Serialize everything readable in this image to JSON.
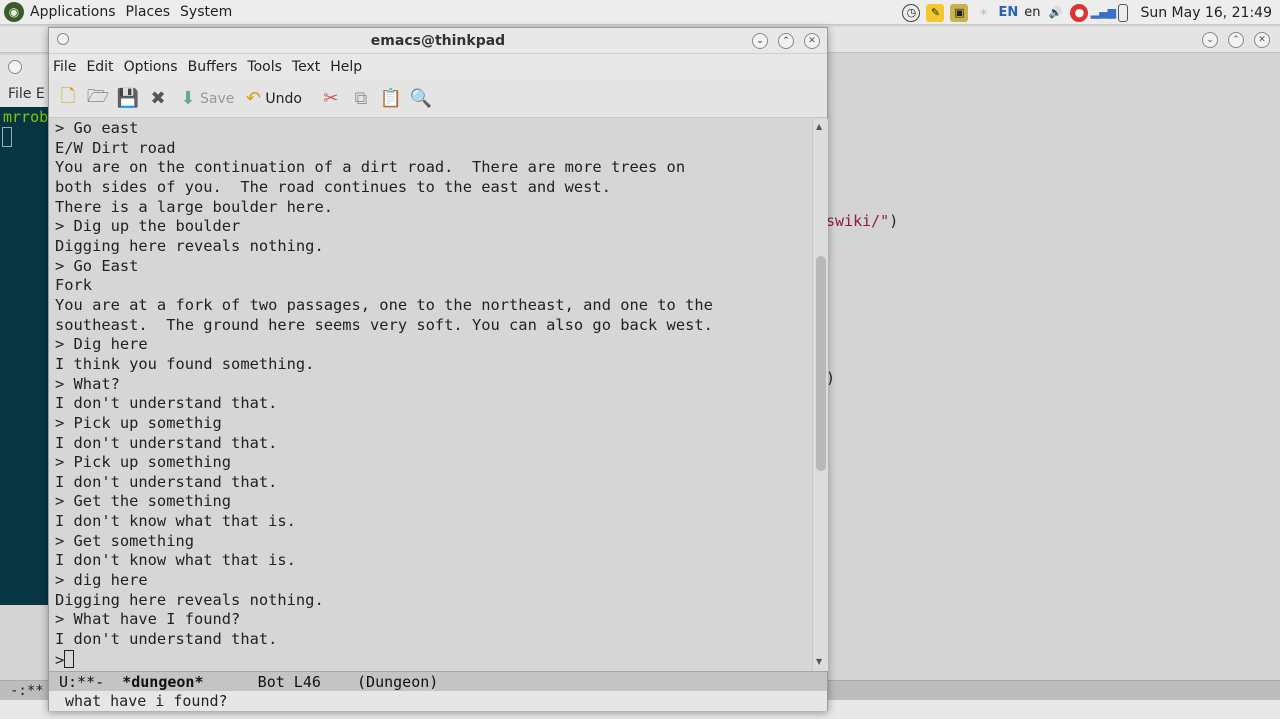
{
  "panel": {
    "menus": [
      "Applications",
      "Places",
      "System"
    ],
    "tray": {
      "lang_upper": "EN",
      "lang_lower": "en",
      "clock": "Sun May 16, 21:49"
    }
  },
  "background": {
    "code_line1": "swiki/\"",
    "code_line1_close": ")",
    "code_line2": ")",
    "modeline": "-:**",
    "terminal_menu": "File  E",
    "terminal_prompt": "mrrob"
  },
  "emacs": {
    "title": "emacs@thinkpad",
    "menu": [
      "File",
      "Edit",
      "Options",
      "Buffers",
      "Tools",
      "Text",
      "Help"
    ],
    "toolbar": {
      "save_label": "Save",
      "undo_label": "Undo"
    },
    "buffer_lines": [
      "> Go east",
      "E/W Dirt road",
      "You are on the continuation of a dirt road.  There are more trees on",
      "both sides of you.  The road continues to the east and west.",
      "There is a large boulder here.",
      "> Dig up the boulder",
      "Digging here reveals nothing.",
      "> Go East",
      "Fork",
      "You are at a fork of two passages, one to the northeast, and one to the",
      "southeast.  The ground here seems very soft. You can also go back west.",
      "> Dig here",
      "I think you found something.",
      "> What?",
      "I don't understand that.",
      "> Pick up somethig",
      "I don't understand that.",
      "> Pick up something",
      "I don't understand that.",
      "> Get the something",
      "I don't know what that is.",
      "> Get something",
      "I don't know what that is.",
      "> dig here",
      "Digging here reveals nothing.",
      "> What have I found?",
      "I don't understand that."
    ],
    "prompt": ">",
    "modeline": {
      "status": "U:**-  ",
      "buffer": "*dungeon*",
      "position": "      Bot L46    (Dungeon)"
    },
    "echo": "what have i found?"
  },
  "colors": {
    "terminal_bg": "#073642",
    "prompt_green": "#85c400",
    "string_color": "#8b1a4a"
  }
}
